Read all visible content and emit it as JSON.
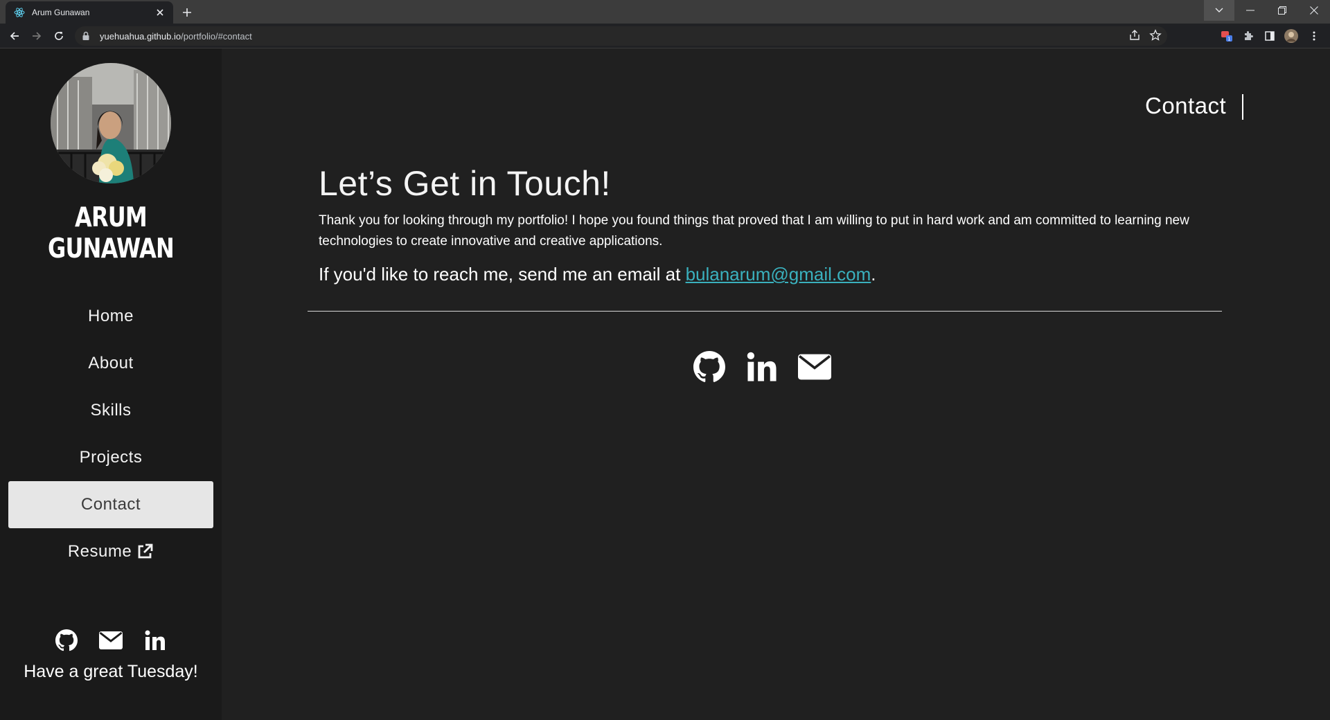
{
  "browser": {
    "tab_title": "Arum Gunawan",
    "url_host": "yuehuahua.github.io",
    "url_path": "/portfolio/#contact"
  },
  "sidebar": {
    "name": "ARUM GUNAWAN",
    "nav": [
      {
        "label": "Home"
      },
      {
        "label": "About"
      },
      {
        "label": "Skills"
      },
      {
        "label": "Projects"
      },
      {
        "label": "Contact",
        "active": true
      },
      {
        "label": "Resume"
      }
    ],
    "social_icons": [
      "github-icon",
      "email-icon",
      "linkedin-icon"
    ],
    "greeting": "Have a great Tuesday!"
  },
  "main": {
    "section_title": "Contact",
    "heading": "Let’s Get in Touch!",
    "paragraph": "Thank you for looking through my portfolio! I hope you found things that proved that I am willing to put in hard work and am committed to learning new technologies to create innovative and creative applications.",
    "reach_text": "If you'd like to reach me, send me an email at ",
    "email": "bulanarum@gmail.com",
    "reach_end": ".",
    "social_icons": [
      "github-icon",
      "linkedin-icon",
      "email-icon"
    ]
  },
  "colors": {
    "background": "#202020",
    "sidebar": "#1a1a1a",
    "link": "#3ab1be",
    "active_nav": "#e6e6e6"
  }
}
